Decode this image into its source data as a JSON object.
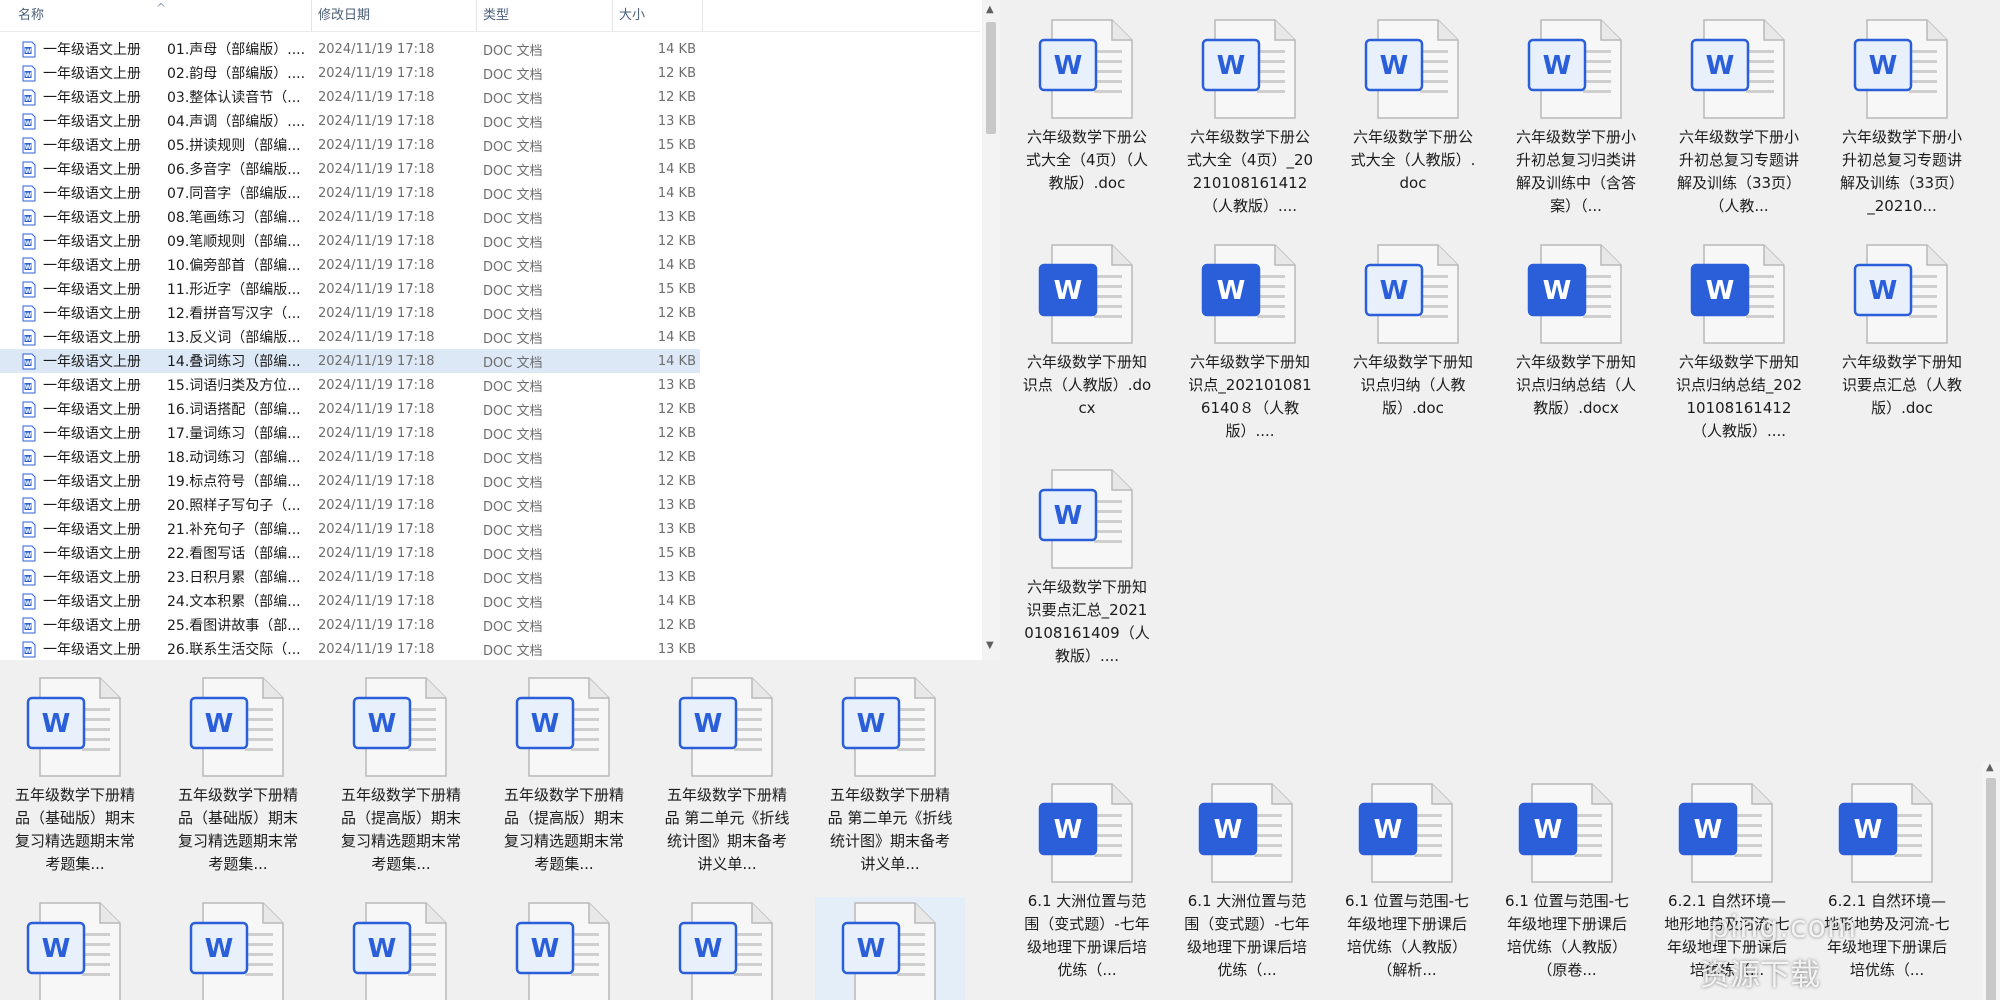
{
  "details": {
    "columns": {
      "name": "名称",
      "date": "修改日期",
      "type": "类型",
      "size": "大小"
    },
    "rows": [
      {
        "name": "一年级语文上册",
        "title": "01.声母（部编版）....",
        "date": "2024/11/19 17:18",
        "type": "DOC 文档",
        "size": "14 KB"
      },
      {
        "name": "一年级语文上册",
        "title": "02.韵母（部编版）....",
        "date": "2024/11/19 17:18",
        "type": "DOC 文档",
        "size": "12 KB"
      },
      {
        "name": "一年级语文上册",
        "title": "03.整体认读音节（...",
        "date": "2024/11/19 17:18",
        "type": "DOC 文档",
        "size": "12 KB"
      },
      {
        "name": "一年级语文上册",
        "title": "04.声调（部编版）....",
        "date": "2024/11/19 17:18",
        "type": "DOC 文档",
        "size": "13 KB"
      },
      {
        "name": "一年级语文上册",
        "title": "05.拼读规则（部编...",
        "date": "2024/11/19 17:18",
        "type": "DOC 文档",
        "size": "15 KB"
      },
      {
        "name": "一年级语文上册",
        "title": "06.多音字（部编版...",
        "date": "2024/11/19 17:18",
        "type": "DOC 文档",
        "size": "14 KB"
      },
      {
        "name": "一年级语文上册",
        "title": "07.同音字（部编版...",
        "date": "2024/11/19 17:18",
        "type": "DOC 文档",
        "size": "14 KB"
      },
      {
        "name": "一年级语文上册",
        "title": "08.笔画练习（部编...",
        "date": "2024/11/19 17:18",
        "type": "DOC 文档",
        "size": "13 KB"
      },
      {
        "name": "一年级语文上册",
        "title": "09.笔顺规则（部编...",
        "date": "2024/11/19 17:18",
        "type": "DOC 文档",
        "size": "12 KB"
      },
      {
        "name": "一年级语文上册",
        "title": "10.偏旁部首（部编...",
        "date": "2024/11/19 17:18",
        "type": "DOC 文档",
        "size": "14 KB"
      },
      {
        "name": "一年级语文上册",
        "title": "11.形近字（部编版...",
        "date": "2024/11/19 17:18",
        "type": "DOC 文档",
        "size": "15 KB"
      },
      {
        "name": "一年级语文上册",
        "title": "12.看拼音写汉字（...",
        "date": "2024/11/19 17:18",
        "type": "DOC 文档",
        "size": "12 KB"
      },
      {
        "name": "一年级语文上册",
        "title": "13.反义词（部编版...",
        "date": "2024/11/19 17:18",
        "type": "DOC 文档",
        "size": "14 KB"
      },
      {
        "name": "一年级语文上册",
        "title": "14.叠词练习（部编...",
        "date": "2024/11/19 17:18",
        "type": "DOC 文档",
        "size": "14 KB"
      },
      {
        "name": "一年级语文上册",
        "title": "15.词语归类及方位...",
        "date": "2024/11/19 17:18",
        "type": "DOC 文档",
        "size": "13 KB"
      },
      {
        "name": "一年级语文上册",
        "title": "16.词语搭配（部编...",
        "date": "2024/11/19 17:18",
        "type": "DOC 文档",
        "size": "12 KB"
      },
      {
        "name": "一年级语文上册",
        "title": "17.量词练习（部编...",
        "date": "2024/11/19 17:18",
        "type": "DOC 文档",
        "size": "12 KB"
      },
      {
        "name": "一年级语文上册",
        "title": "18.动词练习（部编...",
        "date": "2024/11/19 17:18",
        "type": "DOC 文档",
        "size": "12 KB"
      },
      {
        "name": "一年级语文上册",
        "title": "19.标点符号（部编...",
        "date": "2024/11/19 17:18",
        "type": "DOC 文档",
        "size": "12 KB"
      },
      {
        "name": "一年级语文上册",
        "title": "20.照样子写句子（...",
        "date": "2024/11/19 17:18",
        "type": "DOC 文档",
        "size": "13 KB"
      },
      {
        "name": "一年级语文上册",
        "title": "21.补充句子（部编...",
        "date": "2024/11/19 17:18",
        "type": "DOC 文档",
        "size": "13 KB"
      },
      {
        "name": "一年级语文上册",
        "title": "22.看图写话（部编...",
        "date": "2024/11/19 17:18",
        "type": "DOC 文档",
        "size": "15 KB"
      },
      {
        "name": "一年级语文上册",
        "title": "23.日积月累（部编...",
        "date": "2024/11/19 17:18",
        "type": "DOC 文档",
        "size": "13 KB"
      },
      {
        "name": "一年级语文上册",
        "title": "24.文本积累（部编...",
        "date": "2024/11/19 17:18",
        "type": "DOC 文档",
        "size": "14 KB"
      },
      {
        "name": "一年级语文上册",
        "title": "25.看图讲故事（部...",
        "date": "2024/11/19 17:18",
        "type": "DOC 文档",
        "size": "12 KB"
      },
      {
        "name": "一年级语文上册",
        "title": "26.联系生活交际（...",
        "date": "2024/11/19 17:18",
        "type": "DOC 文档",
        "size": "13 KB"
      }
    ]
  },
  "panel_top_right": {
    "tiles": [
      {
        "label": "六年级数学下册公式大全（4页）（人教版）.doc",
        "icon": "word-doc-icon"
      },
      {
        "label": "六年级数学下册公式大全（4页）_20210108161412（人教版）....",
        "icon": "word-doc-icon"
      },
      {
        "label": "六年级数学下册公式大全（人教版）.doc",
        "icon": "word-doc-icon"
      },
      {
        "label": "六年级数学下册小升初总复习归类讲解及训练中（含答案）（...",
        "icon": "word-doc-icon"
      },
      {
        "label": "六年级数学下册小升初总复习专题讲解及训练（33页）（人教...",
        "icon": "word-doc-icon"
      },
      {
        "label": "六年级数学下册小升初总复习专题讲解及训练（33页）_20210...",
        "icon": "word-doc-icon"
      },
      {
        "label": "六年级数学下册知识点（人教版）.docx",
        "icon": "word-docx-icon"
      },
      {
        "label": "六年级数学下册知识点_2021010816140８（人教版）....",
        "icon": "word-docx-icon"
      },
      {
        "label": "六年级数学下册知识点归纳（人教版）.doc",
        "icon": "word-doc-icon"
      },
      {
        "label": "六年级数学下册知识点归纳总结（人教版）.docx",
        "icon": "word-docx-icon"
      },
      {
        "label": "六年级数学下册知识点归纳总结_20210108161412（人教版）....",
        "icon": "word-docx-icon"
      },
      {
        "label": "六年级数学下册知识要点汇总（人教版）.doc",
        "icon": "word-doc-icon"
      },
      {
        "label": "六年级数学下册知识要点汇总_20210108161409（人教版）....",
        "icon": "word-doc-icon"
      }
    ]
  },
  "panel_bottom_left": {
    "tiles": [
      {
        "label": "五年级数学下册精品（基础版）期末复习精选题期末常考题集...",
        "icon": "word-doc-icon"
      },
      {
        "label": "五年级数学下册精品（基础版）期末复习精选题期末常考题集...",
        "icon": "word-doc-icon"
      },
      {
        "label": "五年级数学下册精品（提高版）期末复习精选题期末常考题集...",
        "icon": "word-doc-icon"
      },
      {
        "label": "五年级数学下册精品（提高版）期末复习精选题期末常考题集...",
        "icon": "word-doc-icon"
      },
      {
        "label": "五年级数学下册精品 第二单元《折线统计图》期末备考讲义单...",
        "icon": "word-doc-icon"
      },
      {
        "label": "五年级数学下册精品 第二单元《折线统计图》期末备考讲义单...",
        "icon": "word-doc-icon"
      },
      {
        "label": "",
        "icon": "word-doc-icon"
      },
      {
        "label": "",
        "icon": "word-doc-icon"
      },
      {
        "label": "",
        "icon": "word-doc-icon"
      },
      {
        "label": "",
        "icon": "word-doc-icon"
      },
      {
        "label": "",
        "icon": "word-doc-icon"
      },
      {
        "label": "",
        "icon": "word-doc-icon"
      }
    ]
  },
  "panel_bottom_right": {
    "tiles": [
      {
        "label": "6.1 大洲位置与范围（变式题）-七年级地理下册课后培优练（...",
        "icon": "word-docx-icon"
      },
      {
        "label": "6.1 大洲位置与范围（变式题）-七年级地理下册课后培优练（...",
        "icon": "word-docx-icon"
      },
      {
        "label": "6.1 位置与范围-七年级地理下册课后培优练（人教版）（解析...",
        "icon": "word-docx-icon"
      },
      {
        "label": "6.1 位置与范围-七年级地理下册课后培优练（人教版）（原卷...",
        "icon": "word-docx-icon"
      },
      {
        "label": "6.2.1 自然环境—地形地势及河流-七年级地理下册课后培优练（...",
        "icon": "word-docx-icon"
      },
      {
        "label": "6.2.1 自然环境—地形地势及河流-七年级地理下册课后培优练（...",
        "icon": "word-docx-icon"
      }
    ]
  },
  "watermark": {
    "line1": "ping.com",
    "line2": "资源下载"
  },
  "colors": {
    "word_blue": "#2b5fd9",
    "word_light": "#5f95ea",
    "selection": "#dce8f5"
  }
}
